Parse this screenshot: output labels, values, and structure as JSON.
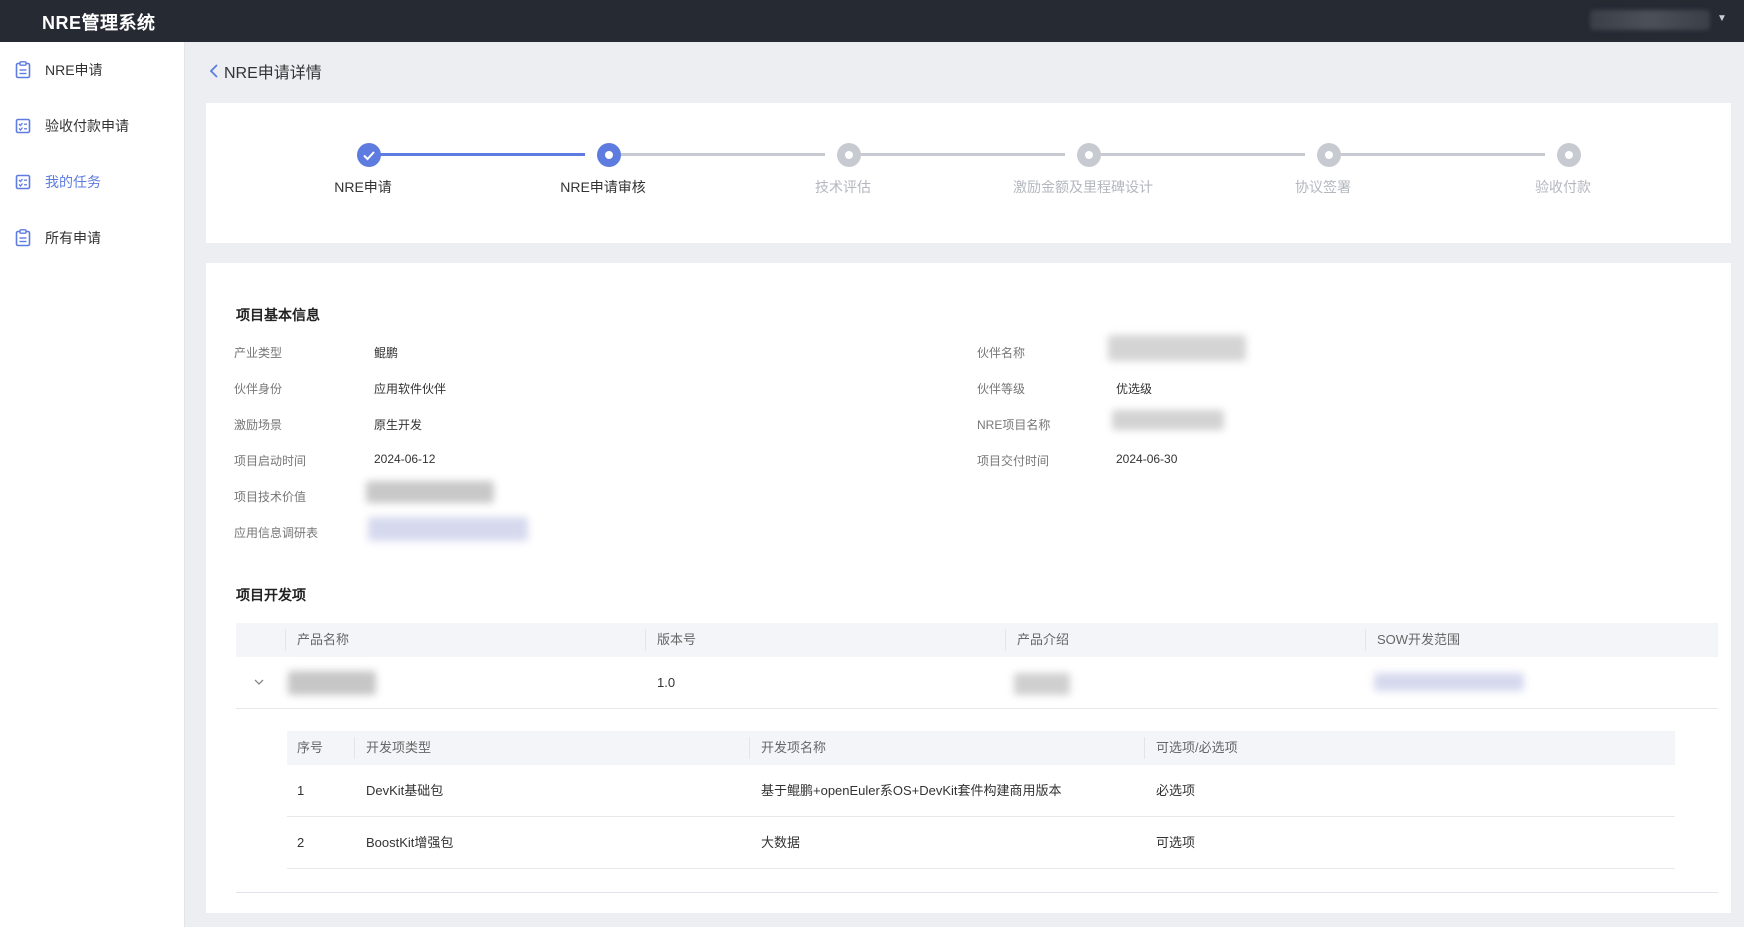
{
  "app": {
    "title": "NRE管理系统"
  },
  "sidebar": {
    "items": [
      {
        "label": "NRE申请",
        "icon": "clipboard-icon"
      },
      {
        "label": "验收付款申请",
        "icon": "checklist-icon"
      },
      {
        "label": "我的任务",
        "icon": "checklist-icon",
        "active": true
      },
      {
        "label": "所有申请",
        "icon": "clipboard-icon"
      }
    ]
  },
  "page": {
    "back_icon": "chevron-left-icon",
    "title": "NRE申请详情"
  },
  "steps": [
    {
      "label": "NRE申请",
      "status": "done"
    },
    {
      "label": "NRE申请审核",
      "status": "current"
    },
    {
      "label": "技术评估",
      "status": "pending"
    },
    {
      "label": "激励金额及里程碑设计",
      "status": "pending"
    },
    {
      "label": "协议签署",
      "status": "pending"
    },
    {
      "label": "验收付款",
      "status": "pending"
    }
  ],
  "colors": {
    "primary": "#5e7ce0",
    "pending": "#c7cad1",
    "topbar": "#252a33"
  },
  "basic_info": {
    "title": "项目基本信息",
    "left": [
      {
        "label": "产业类型",
        "value": "鲲鹏"
      },
      {
        "label": "伙伴身份",
        "value": "应用软件伙伴"
      },
      {
        "label": "激励场景",
        "value": "原生开发"
      },
      {
        "label": "项目启动时间",
        "value": "2024-06-12"
      },
      {
        "label": "项目技术价值",
        "value": ""
      },
      {
        "label": "应用信息调研表",
        "value": ""
      }
    ],
    "right": [
      {
        "label": "伙伴名称",
        "value": ""
      },
      {
        "label": "伙伴等级",
        "value": "优选级"
      },
      {
        "label": "NRE项目名称",
        "value": ""
      },
      {
        "label": "项目交付时间",
        "value": "2024-06-30"
      }
    ]
  },
  "dev_items": {
    "title": "项目开发项",
    "columns": [
      "产品名称",
      "版本号",
      "产品介绍",
      "SOW开发范围"
    ],
    "rows": [
      {
        "product": "",
        "version": "1.0",
        "intro": "",
        "sow": ""
      }
    ],
    "expand_icon": "chevron-down-icon",
    "sub_columns": [
      "序号",
      "开发项类型",
      "开发项名称",
      "可选项/必选项"
    ],
    "sub_rows": [
      {
        "no": "1",
        "type": "DevKit基础包",
        "name": "基于鲲鹏+openEuler系OS+DevKit套件构建商用版本",
        "required": "必选项"
      },
      {
        "no": "2",
        "type": "BoostKit增强包",
        "name": "大数据",
        "required": "可选项"
      }
    ]
  }
}
